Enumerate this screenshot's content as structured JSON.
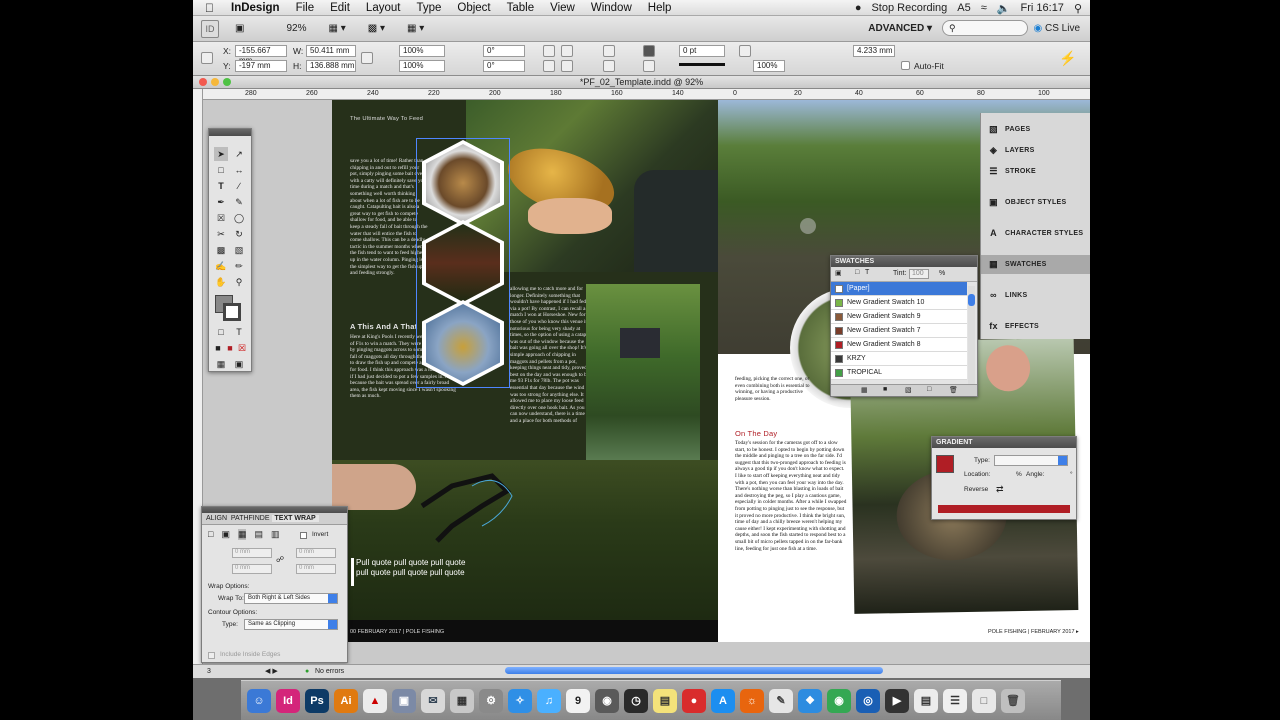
{
  "menubar": {
    "app_name": "InDesign",
    "menus": [
      "File",
      "Edit",
      "Layout",
      "Type",
      "Object",
      "Table",
      "View",
      "Window",
      "Help"
    ],
    "recording": "Stop Recording",
    "clock": "Fri 16:17"
  },
  "appbar": {
    "zoom": "92%",
    "workspace": "ADVANCED ▾",
    "cs_live": "CS Live"
  },
  "control": {
    "x_label": "X:",
    "x_value": "-155.667 mm",
    "y_label": "Y:",
    "y_value": "-197 mm",
    "w_label": "W:",
    "w_value": "50.411 mm",
    "h_label": "H:",
    "h_value": "136.888 mm",
    "scale_x": "100%",
    "scale_y": "100%",
    "angle": "0°",
    "shear": "0°",
    "stroke_weight": "0 pt",
    "opacity": "100%",
    "offset": "4.233 mm",
    "autofit": "Auto-Fit"
  },
  "document": {
    "title": "*PF_02_Template.indd @ 92%",
    "ruler_marks": [
      "280",
      "260",
      "240",
      "220",
      "200",
      "180",
      "160",
      "140",
      "120",
      "100",
      "80",
      "60",
      "40",
      "20",
      "0",
      "20",
      "40",
      "60",
      "80",
      "100",
      "120",
      "140"
    ]
  },
  "page": {
    "kicker": "The Ultimate Way To Feed",
    "col1": "save you a lot of time! Rather than chipping in and out to refill your pot, simply pinging some bait over with a catty will definitely save you time during a match and that's something well worth thinking about when a lot of fish are to be caught. Catapulting bait is also a great way to get fish to compete shallow for food, and be able to keep a steady fall of bait through the water that will entice the fish to come shallow. This can be a deadly tactic in the summer months when the fish tend to want to feed higher up in the water column. Pinging is the simplest way to get the fish up and feeding strongly.",
    "heading1": "A This And A That",
    "col1b": "Here at King's Pools I recently weighed in 192lb of F1s to win a match. They were caught shallow, by pinging maggots across to some lily pads. The fall of maggots all day through the water managed to draw the fish up and compete against each other for food. I think this approach was a lot better than if I had just decided to pot a few samples in. Also, because the bait was spread over a fairly broad area, the fish kept moving since I wasn't spooking them as much.",
    "col2": "allowing me to catch more and for longer. Definitely something that wouldn't have happened if I had fed via a pot! By contrast, I can recall a match I won at Horseshoe. New for those of you who know this venue it's notorious for being very shady at times, so the option of using a catapult was out of the window because the bait was going all over the shop! It's a simple approach of chipping in maggots and pellets from a pot, keeping things neat and tidy, proved best on the day and was enough to bag me 93 F1s for 78lb. The pot was essential that day because the wind was too strong for anything else. It allowed me to place my loose feed directly over one hook bait. As you can now understand, there is a time and a place for both methods of",
    "pull_quote": "Pull quote pull quote pull quote pull quote pull quote pull quote",
    "folio_left": "00 FEBRUARY 2017 | POLE FISHING",
    "right_col_a": "feeding, picking the correct one, or even combining both is essential to winning, or having a productive pleasure session.",
    "heading2": "On The Day",
    "right_col_b": "Today's session for the cameras got off to a slow start, to be honest. I opted to begin by potting down the middle and pinging to a tree on the far side. I'd suggest that this two-pronged approach to feeding is always a good tip if you don't know what to expect. I like to start off keeping everything neat and tidy with a pot, then you can feel your way into the day. There's nothing worse than blasting in loads of bait and destroying the peg, so I play a cautious game, especially in colder months. After a while I swapped from potting to pinging just to see the response, but it proved no more productive. I think the bright sun, time of day and a chilly breeze weren't helping my cause either! I kept experimenting with shotting and depths, and soon the fish started to respond best to a small bit of micro pellets tapped in on the far-bank line, feeding for just one fish at a time.",
    "folio_right": "POLE FISHING | FEBRUARY 2017 ▸"
  },
  "dock": {
    "items": [
      "PAGES",
      "LAYERS",
      "STROKE",
      "OBJECT STYLES",
      "CHARACTER STYLES",
      "SWATCHES",
      "LINKS",
      "EFFECTS"
    ]
  },
  "swatches": {
    "title": "SWATCHES",
    "tint_label": "Tint:",
    "tint_value": "100",
    "tint_unit": "%",
    "rows": [
      {
        "name": "[Paper]",
        "color": "#ffffff"
      },
      {
        "name": "New Gradient Swatch 10",
        "color": "#7ab648"
      },
      {
        "name": "New Gradient Swatch 9",
        "color": "#8a5a3a"
      },
      {
        "name": "New Gradient Swatch 7",
        "color": "#7a3d2a"
      },
      {
        "name": "New Gradient Swatch 8",
        "color": "#b01e25"
      },
      {
        "name": "KRZY",
        "color": "#3a3a3a"
      },
      {
        "name": "TROPICAL",
        "color": "#43a047"
      }
    ]
  },
  "gradient": {
    "title": "GRADIENT",
    "type_label": "Type:",
    "location_label": "Location:",
    "location_unit": "%",
    "angle_label": "Angle:",
    "angle_unit": "°",
    "reverse_label": "Reverse",
    "color": "#b01e25"
  },
  "textwrap": {
    "tabs": [
      "ALIGN",
      "PATHFINDE",
      "TEXT WRAP"
    ],
    "invert": "Invert",
    "top_offset": "0 mm",
    "bottom_offset": "0 mm",
    "left_offset": "0 mm",
    "right_offset": "0 mm",
    "wrap_options": "Wrap Options:",
    "wrap_to_label": "Wrap To:",
    "wrap_to_value": "Both Right & Left Sides",
    "contour_options": "Contour Options:",
    "type_label": "Type:",
    "type_value": "Same as Clipping",
    "inside_edges": "Include Inside Edges"
  },
  "status": {
    "page": "3",
    "errors": "No errors"
  },
  "macdock": [
    "Finder",
    "InDesign",
    "Photoshop",
    "Illustrator",
    "Acrobat",
    "Preview",
    "Mail",
    "Calculator",
    "System Prefs",
    "Safari",
    "iTunes",
    "Calendar",
    "Photo Booth",
    "Dashboard",
    "Stickies",
    "Music",
    "App Store",
    "Firefox",
    "Scripts",
    "Dropbox",
    "Chrome",
    "Network",
    "Movie",
    "Outlook",
    "Notes",
    "Script Editor",
    "Trash"
  ]
}
